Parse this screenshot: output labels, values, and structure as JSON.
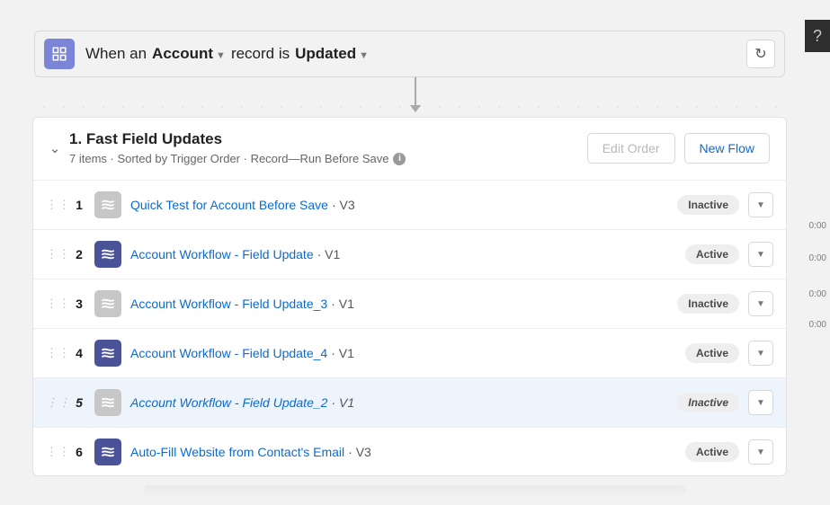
{
  "help_label": "?",
  "trigger": {
    "prefix": "When an",
    "object": "Account",
    "mid": "record is",
    "action": "Updated"
  },
  "section": {
    "title": "1. Fast Field Updates",
    "subtitle": "7 items · Sorted by Trigger Order · Record—Run Before Save",
    "edit_order_label": "Edit Order",
    "new_flow_label": "New Flow"
  },
  "rows": [
    {
      "num": "1",
      "title": "Quick Test for Account Before Save",
      "version": "V3",
      "status": "Inactive",
      "active": false,
      "highlight": false
    },
    {
      "num": "2",
      "title": "Account Workflow - Field Update",
      "version": "V1",
      "status": "Active",
      "active": true,
      "highlight": false
    },
    {
      "num": "3",
      "title": "Account Workflow - Field Update_3",
      "version": "V1",
      "status": "Inactive",
      "active": false,
      "highlight": false
    },
    {
      "num": "4",
      "title": "Account Workflow - Field Update_4",
      "version": "V1",
      "status": "Active",
      "active": true,
      "highlight": false
    },
    {
      "num": "5",
      "title": "Account Workflow - Field Update_2",
      "version": "V1",
      "status": "Inactive",
      "active": false,
      "highlight": true
    },
    {
      "num": "6",
      "title": "Auto-Fill Website from Contact's Email",
      "version": "V3",
      "status": "Active",
      "active": true,
      "highlight": false
    }
  ],
  "side_timestamps": [
    "0:00",
    "0:00",
    "0:00",
    "0:00"
  ]
}
